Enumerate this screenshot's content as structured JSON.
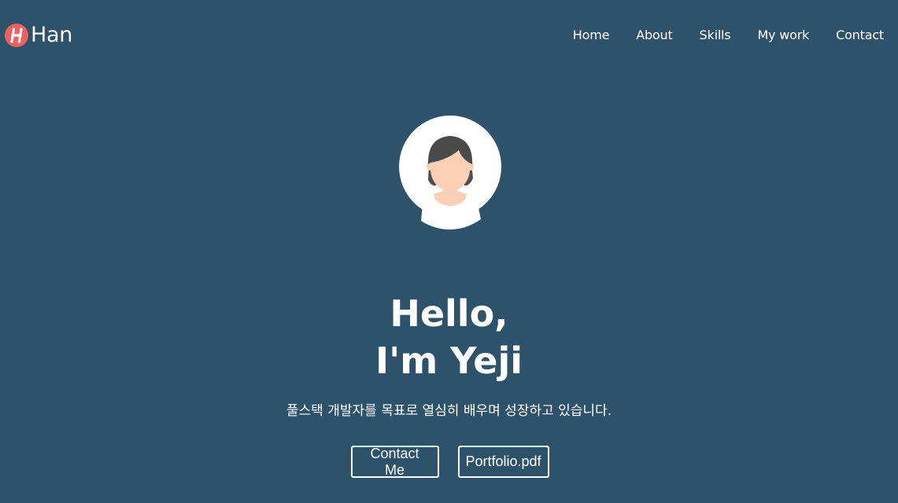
{
  "logo": {
    "badge_letter": "H",
    "text": "Han",
    "badge_color": "#f05f5f"
  },
  "nav": {
    "items": [
      {
        "label": "Home"
      },
      {
        "label": "About"
      },
      {
        "label": "Skills"
      },
      {
        "label": "My work"
      },
      {
        "label": "Contact"
      }
    ]
  },
  "hero": {
    "avatar_icon": "woman-avatar-icon",
    "title_line1": "Hello,",
    "title_line2": "I'm Yeji",
    "description": "풀스택 개발자를 목표로 열심히 배우며 성장하고 있습니다.",
    "buttons": {
      "contact_label": "Contact Me",
      "portfolio_label": "Portfolio.pdf"
    }
  },
  "colors": {
    "background": "#2d5269",
    "text": "#ffffff",
    "accent": "#f05f5f"
  }
}
